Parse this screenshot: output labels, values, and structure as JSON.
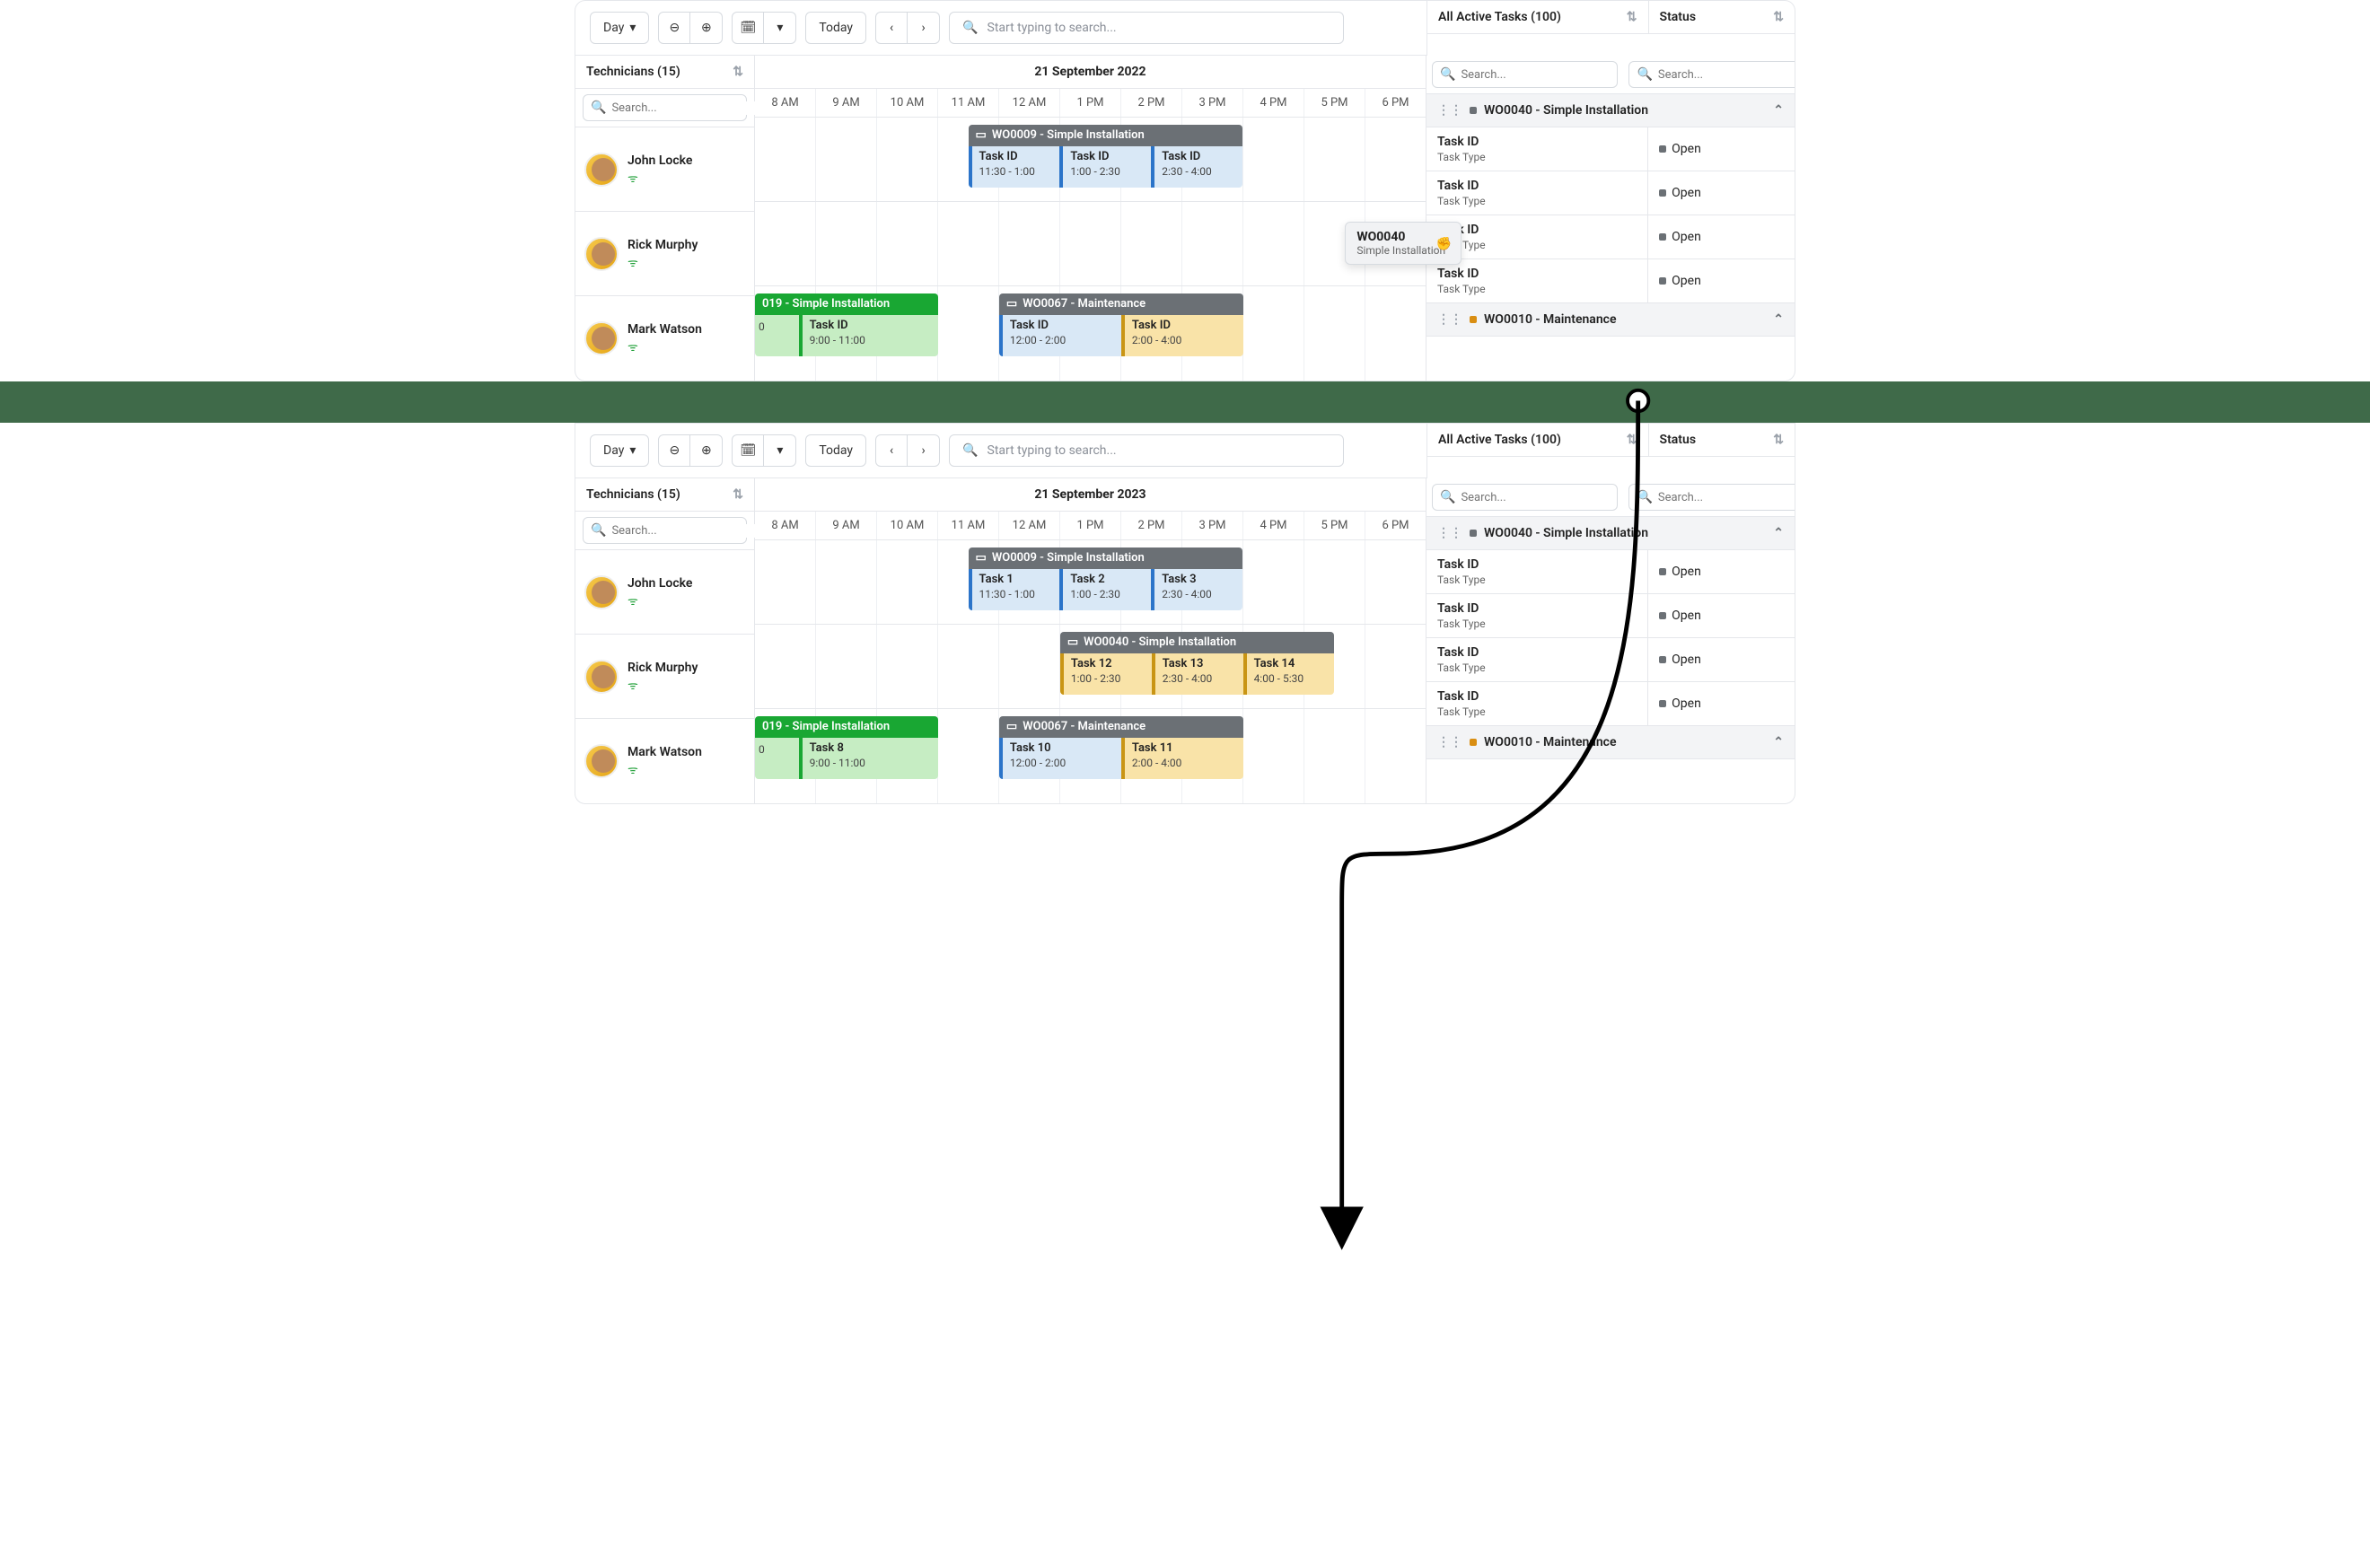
{
  "toolbar": {
    "view_label": "Day",
    "today_label": "Today",
    "search_placeholder": "Start typing to search..."
  },
  "technicians": {
    "header": "Technicians (15)",
    "search_placeholder": "Search...",
    "list": [
      {
        "name": "John Locke"
      },
      {
        "name": "Rick Murphy"
      },
      {
        "name": "Mark Watson"
      }
    ]
  },
  "panel_top": {
    "date": "21 September 2022",
    "hours": [
      "8 AM",
      "9 AM",
      "10 AM",
      "11 AM",
      "12 AM",
      "1 PM",
      "2 PM",
      "3 PM",
      "4 PM",
      "5 PM",
      "6 PM"
    ],
    "rows": {
      "john": {
        "wo": {
          "title": "WO0009 - Simple Installation",
          "tasks": [
            {
              "label": "Task ID",
              "time": "11:30 - 1:00"
            },
            {
              "label": "Task ID",
              "time": "1:00 - 2:30"
            },
            {
              "label": "Task ID",
              "time": "2:30 - 4:00"
            }
          ]
        }
      },
      "mark": {
        "wo1": {
          "title": "019 - Simple Installation",
          "task": {
            "label": "Task ID",
            "time": "9:00 - 11:00"
          },
          "truncated_time": "0"
        },
        "wo2": {
          "title": "WO0067 - Maintenance",
          "tasks": [
            {
              "label": "Task ID",
              "time": "12:00 - 2:00"
            },
            {
              "label": "Task ID",
              "time": "2:00 - 4:00"
            }
          ]
        }
      }
    },
    "drag": {
      "id": "WO0040",
      "type": "Simple Installation"
    }
  },
  "panel_bottom": {
    "date": "21 September 2023",
    "rows": {
      "john": {
        "wo": {
          "title": "WO0009 - Simple Installation",
          "tasks": [
            {
              "label": "Task 1",
              "time": "11:30 - 1:00"
            },
            {
              "label": "Task 2",
              "time": "1:00 - 2:30"
            },
            {
              "label": "Task 3",
              "time": "2:30 - 4:00"
            }
          ]
        }
      },
      "rick": {
        "wo": {
          "title": "WO0040 - Simple Installation",
          "tasks": [
            {
              "label": "Task 12",
              "time": "1:00 - 2:30"
            },
            {
              "label": "Task 13",
              "time": "2:30 - 4:00"
            },
            {
              "label": "Task 14",
              "time": "4:00 - 5:30"
            }
          ]
        }
      },
      "mark": {
        "wo1": {
          "title": "019 - Simple Installation",
          "task": {
            "label": "Task 8",
            "time": "9:00 - 11:00"
          },
          "truncated_time": "0"
        },
        "wo2": {
          "title": "WO0067 - Maintenance",
          "tasks": [
            {
              "label": "Task 10",
              "time": "12:00 - 2:00"
            },
            {
              "label": "Task 11",
              "time": "2:00 - 4:00"
            }
          ]
        }
      }
    }
  },
  "right": {
    "header_tasks": "All Active Tasks (100)",
    "header_status": "Status",
    "search_placeholder": "Search...",
    "groups": [
      {
        "title": "WO0040 - Simple Installation",
        "dot": "gray"
      },
      {
        "title": "WO0010 - Maintenance",
        "dot": "orange"
      }
    ],
    "task_row": {
      "id": "Task ID",
      "type": "Task Type",
      "status": "Open"
    }
  }
}
